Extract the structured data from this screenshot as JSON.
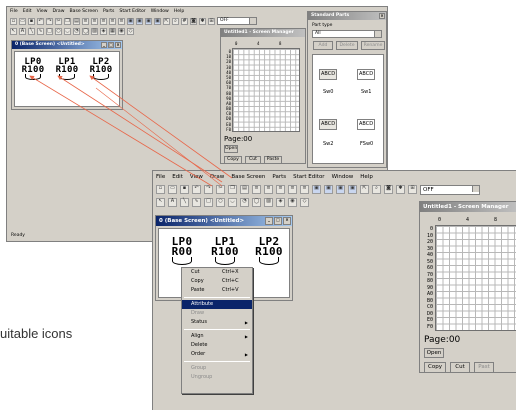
{
  "top_window": {
    "menu": [
      "File",
      "Edit",
      "View",
      "Draw",
      "Base Screen",
      "Parts",
      "Start Editor",
      "Window",
      "Help"
    ],
    "combo_value": "OFF",
    "base_screen_title": "0 (Base Screen) <Untitled>",
    "lamps": [
      {
        "label": "LP0",
        "value": "R100"
      },
      {
        "label": "LP1",
        "value": "R100"
      },
      {
        "label": "LP2",
        "value": "R100"
      }
    ],
    "screen_window_title": "Untitled1 - Screen Manager",
    "row_labels": [
      "0",
      "10",
      "20",
      "30",
      "40",
      "50",
      "60",
      "70",
      "80",
      "90",
      "A0",
      "B0",
      "C0",
      "D0",
      "E0",
      "F0"
    ],
    "col_labels": [
      "0",
      "4",
      "8"
    ],
    "page_label": "Page:00",
    "buttons": {
      "open": "Open",
      "copy": "Copy",
      "cut": "Cut",
      "paste": "Paste"
    },
    "status": "Ready",
    "parts_panel": {
      "title": "Standard Parts",
      "part_type_label": "Part type",
      "part_type_value": "All",
      "buttons": {
        "add": "Add",
        "delete": "Delete",
        "rename": "Rename"
      },
      "items": [
        {
          "icon": "ABCD",
          "name": "Sw0"
        },
        {
          "icon": "ABCD",
          "name": "Sw1"
        },
        {
          "icon": "ABCD",
          "name": "Sw2"
        },
        {
          "icon": "ABCD",
          "name": "FSw0"
        }
      ]
    }
  },
  "bottom_window": {
    "menu": [
      "File",
      "Edit",
      "View",
      "Draw",
      "Base Screen",
      "Parts",
      "Start Editor",
      "Window",
      "Help"
    ],
    "combo_value": "OFF",
    "base_screen_title": "0 (Base Screen) <Untitled>",
    "lamps": [
      {
        "label": "LP0",
        "value": "R00"
      },
      {
        "label": "LP1",
        "value": "R100"
      },
      {
        "label": "LP2",
        "value": "R100"
      }
    ],
    "screen_window_title": "Untitled1 - Screen Manager",
    "row_labels": [
      "0",
      "10",
      "20",
      "30",
      "40",
      "50",
      "60",
      "70",
      "80",
      "90",
      "A0",
      "B0",
      "C0",
      "D0",
      "E0",
      "F0"
    ],
    "col_labels": [
      "0",
      "4",
      "8"
    ],
    "page_label": "Page:00",
    "buttons": {
      "open": "Open",
      "copy": "Copy",
      "cut": "Cut",
      "paste": "Past"
    },
    "context_menu": [
      {
        "label": "Cut",
        "shortcut": "Ctrl+X",
        "state": "normal"
      },
      {
        "label": "Copy",
        "shortcut": "Ctrl+C",
        "state": "normal"
      },
      {
        "label": "Paste",
        "shortcut": "Ctrl+V",
        "state": "normal"
      },
      {
        "label": "Attribute",
        "shortcut": "",
        "state": "highlighted"
      },
      {
        "label": "Draw",
        "shortcut": "",
        "state": "disabled"
      },
      {
        "label": "Status",
        "shortcut": "",
        "state": "submenu"
      },
      {
        "label": "Align",
        "shortcut": "",
        "state": "submenu"
      },
      {
        "label": "Delete",
        "shortcut": "",
        "state": "normal"
      },
      {
        "label": "Order",
        "shortcut": "",
        "state": "submenu"
      },
      {
        "label": "Group",
        "shortcut": "",
        "state": "disabled"
      },
      {
        "label": "Ungroup",
        "shortcut": "",
        "state": "disabled"
      }
    ]
  },
  "caption": "uitable icons",
  "colors": {
    "arrow": "#e8674a",
    "titlebar_active": "#0a246a",
    "highlight": "#0a246a",
    "window_face": "#d4d0c8"
  }
}
